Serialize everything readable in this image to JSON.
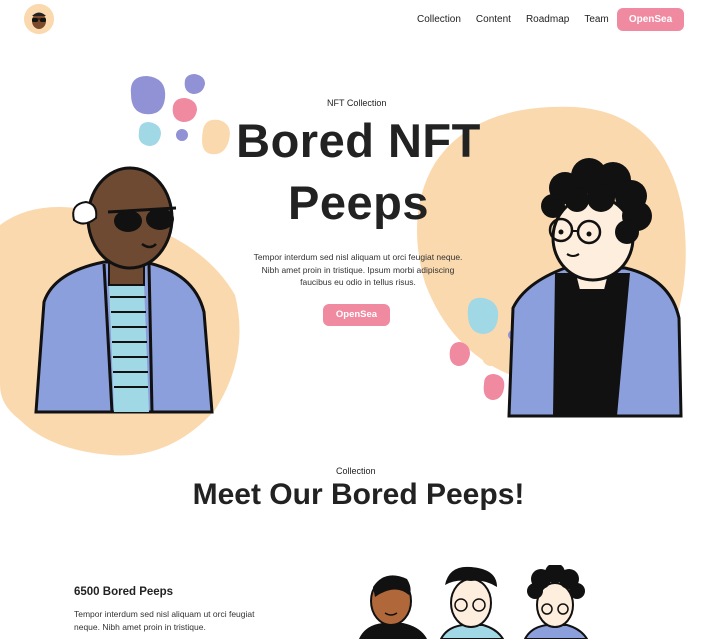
{
  "nav": {
    "logo_icon": "avatar-logo-icon",
    "links": [
      "Collection",
      "Content",
      "Roadmap",
      "Team"
    ],
    "cta_label": "OpenSea"
  },
  "hero": {
    "eyebrow": "NFT Collection",
    "title_line1": "Bored NFT",
    "title_line2": "Peeps",
    "description": "Tempor interdum sed nisl aliquam ut orci feugiat neque. Nibh amet proin in tristique. Ipsum morbi adipiscing faucibus eu odio in tellus risus.",
    "cta_label": "OpenSea"
  },
  "collection": {
    "eyebrow": "Collection",
    "title": "Meet Our Bored Peeps!",
    "stat_title": "6500 Bored Peeps",
    "stat_desc": "Tempor interdum sed nisl aliquam ut orci feugiat neque. Nibh amet proin in tristique."
  },
  "colors": {
    "accent_pink": "#f08aa0",
    "peach": "#fbd9ae",
    "lavender": "#9191d6",
    "sky": "#a0d8e6",
    "jacket_blue": "#8b9fdc"
  }
}
